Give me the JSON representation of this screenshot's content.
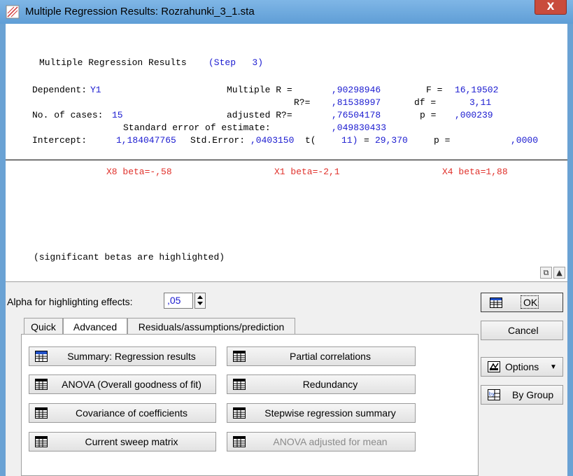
{
  "window": {
    "title": "Multiple Regression Results: Rozrahunki_3_1.sta",
    "close_label": "X"
  },
  "results": {
    "header_label": "Multiple Regression Results",
    "header_step": "(Step   3)",
    "dependent_label": "Dependent:",
    "dependent_value": "Y1",
    "mult_r_label": "Multiple R =",
    "mult_r_value": ",90298946",
    "f_label": "F =",
    "f_value": "16,19502",
    "r2_label": "R?=",
    "r2_value": ",81538997",
    "df_label": "df =",
    "df_value": "3,11",
    "cases_label": "No. of cases:",
    "cases_value": "15",
    "adj_r2_label": "adjusted R?=",
    "adj_r2_value": ",76504178",
    "p_label": "p =",
    "p_value": ",000239",
    "se_label": "Standard error of estimate:",
    "se_value": ",049830433",
    "intercept_label": "Intercept:",
    "intercept_value": "1,184047765",
    "stderr_label": "Std.Error:",
    "stderr_value": ",0403150",
    "t_label": "t(",
    "t_df": "11)",
    "t_eq": "=",
    "t_value": "29,370",
    "p2_label": "p =",
    "p2_value": ",0000",
    "betas": [
      "X8 beta=-,58",
      "X1 beta=-2,1",
      "X4 beta=1,88"
    ],
    "note": "(significant betas are highlighted)"
  },
  "controls": {
    "alpha_label": "Alpha for highlighting effects:",
    "alpha_value": ",05"
  },
  "tabs": [
    {
      "label": "Quick"
    },
    {
      "label": "Advanced"
    },
    {
      "label": "Residuals/assumptions/prediction"
    }
  ],
  "buttons": {
    "summary": "Summary:  Regression results",
    "partial": "Partial correlations",
    "anova": "ANOVA (Overall goodness of fit)",
    "redundancy": "Redundancy",
    "covariance": "Covariance of coefficients",
    "stepwise": "Stepwise regression summary",
    "sweep": "Current sweep matrix",
    "anova_adj": "ANOVA adjusted for mean"
  },
  "side": {
    "ok": "OK",
    "cancel": "Cancel",
    "options": "Options",
    "bygroup": "By Group"
  },
  "colors": {
    "value_blue": "#1a1ad0",
    "beta_red": "#e0302a",
    "title_bar": "#6aa2d4"
  },
  "icons": [
    "app-icon",
    "close-icon",
    "copy-icon",
    "expand-icon",
    "spin-up-icon",
    "spin-down-icon",
    "summary-icon",
    "grid-icon",
    "ok-icon",
    "options-icon",
    "bygroup-icon"
  ]
}
